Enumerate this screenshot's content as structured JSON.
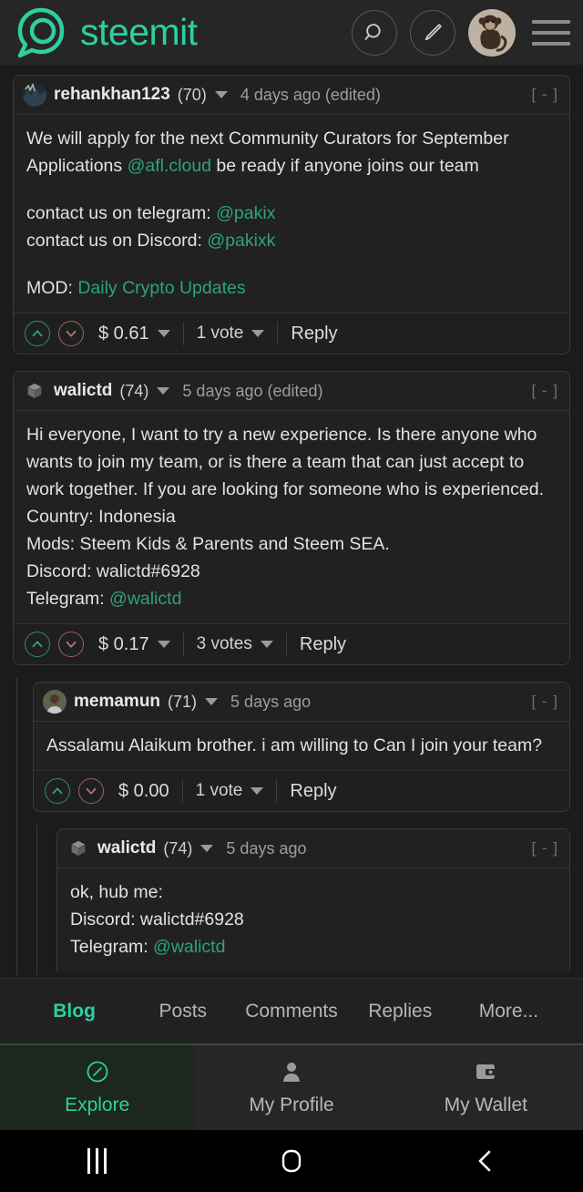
{
  "header": {
    "brand": "steemit",
    "logo_color": "#2ecfa0",
    "search_icon": "search-icon",
    "compose_icon": "pencil-icon",
    "avatar_icon": "monkey-avatar",
    "menu_icon": "hamburger-icon"
  },
  "comments": [
    {
      "author": "rehankhan123",
      "reputation": "(70)",
      "time": "4 days ago (edited)",
      "edited": true,
      "collapse": "[ - ]",
      "avatar": "photo-avatar-rehankhan123",
      "paragraphs": [
        {
          "parts": [
            {
              "text": "We will apply for the next Community Curators for September",
              "type": "plain"
            }
          ]
        },
        {
          "parts": [
            {
              "text": "Applications ",
              "type": "plain"
            },
            {
              "text": "@afl.cloud",
              "type": "link"
            },
            {
              "text": " be ready if anyone joins our team",
              "type": "plain"
            }
          ]
        },
        {
          "gap": true,
          "parts": [
            {
              "text": "contact us on telegram: ",
              "type": "plain"
            },
            {
              "text": "@pakix",
              "type": "link"
            }
          ]
        },
        {
          "parts": [
            {
              "text": "contact us on Discord: ",
              "type": "plain"
            },
            {
              "text": "@pakixk",
              "type": "link"
            }
          ]
        },
        {
          "gap": true,
          "parts": [
            {
              "text": "MOD: ",
              "type": "plain"
            },
            {
              "text": "Daily Crypto Updates",
              "type": "link"
            }
          ]
        }
      ],
      "payout": "$ 0.61",
      "payout_has_caret": true,
      "votes": "1 vote",
      "votes_has_caret": true,
      "reply": "Reply",
      "depth": 0
    },
    {
      "author": "walictd",
      "reputation": "(74)",
      "time": "5 days ago (edited)",
      "edited": true,
      "collapse": "[ - ]",
      "avatar": "cube-placeholder-avatar",
      "paragraphs": [
        {
          "parts": [
            {
              "text": "Hi everyone, I want to try a new experience. Is there anyone who wants to join my team, or is there a team that can just accept to work together. If you are looking for someone who is experienced.",
              "type": "plain"
            }
          ]
        },
        {
          "parts": [
            {
              "text": "Country: Indonesia",
              "type": "plain"
            }
          ]
        },
        {
          "parts": [
            {
              "text": "Mods: Steem Kids & Parents and Steem SEA.",
              "type": "plain"
            }
          ]
        },
        {
          "parts": [
            {
              "text": "Discord: walictd#6928",
              "type": "plain"
            }
          ]
        },
        {
          "parts": [
            {
              "text": "Telegram: ",
              "type": "plain"
            },
            {
              "text": "@walictd",
              "type": "link"
            }
          ]
        }
      ],
      "payout": "$ 0.17",
      "payout_has_caret": true,
      "votes": "3 votes",
      "votes_has_caret": true,
      "reply": "Reply",
      "depth": 0
    },
    {
      "author": "memamun",
      "reputation": "(71)",
      "time": "5 days ago",
      "edited": false,
      "collapse": "[ - ]",
      "avatar": "photo-avatar-memamun",
      "paragraphs": [
        {
          "parts": [
            {
              "text": "Assalamu Alaikum brother. i am willing to Can I join your team?",
              "type": "plain"
            }
          ]
        }
      ],
      "payout": "$ 0.00",
      "payout_has_caret": false,
      "votes": "1 vote",
      "votes_has_caret": true,
      "reply": "Reply",
      "depth": 1
    },
    {
      "author": "walictd",
      "reputation": "(74)",
      "time": "5 days ago",
      "edited": false,
      "collapse": "[ - ]",
      "avatar": "cube-placeholder-avatar",
      "paragraphs": [
        {
          "parts": [
            {
              "text": "ok, hub me:",
              "type": "plain"
            }
          ]
        },
        {
          "parts": [
            {
              "text": "Discord: walictd#6928",
              "type": "plain"
            }
          ]
        },
        {
          "parts": [
            {
              "text": "Telegram: ",
              "type": "plain"
            },
            {
              "text": "@walictd",
              "type": "link"
            }
          ]
        }
      ],
      "payout": "",
      "payout_has_caret": false,
      "votes": "",
      "votes_has_caret": false,
      "reply": "",
      "depth": 2,
      "clipped": true
    }
  ],
  "profile_tabs": {
    "items": [
      {
        "label": "Blog",
        "active": true
      },
      {
        "label": "Posts",
        "active": false
      },
      {
        "label": "Comments",
        "active": false
      },
      {
        "label": "Replies",
        "active": false
      },
      {
        "label": "More...",
        "active": false
      }
    ]
  },
  "bottom_nav": {
    "items": [
      {
        "label": "Explore",
        "icon": "compass-icon",
        "active": true
      },
      {
        "label": "My Profile",
        "icon": "person-icon",
        "active": false
      },
      {
        "label": "My Wallet",
        "icon": "wallet-icon",
        "active": false
      }
    ]
  },
  "system_bar": {
    "recents": "recents-icon",
    "home": "home-icon",
    "back": "back-icon"
  },
  "colors": {
    "accent": "#2ecfa0",
    "link": "#2ea37c",
    "background": "#1b1b1b",
    "card": "#212121",
    "upvote": "#2b8f6c",
    "downvote": "#9c6262"
  }
}
